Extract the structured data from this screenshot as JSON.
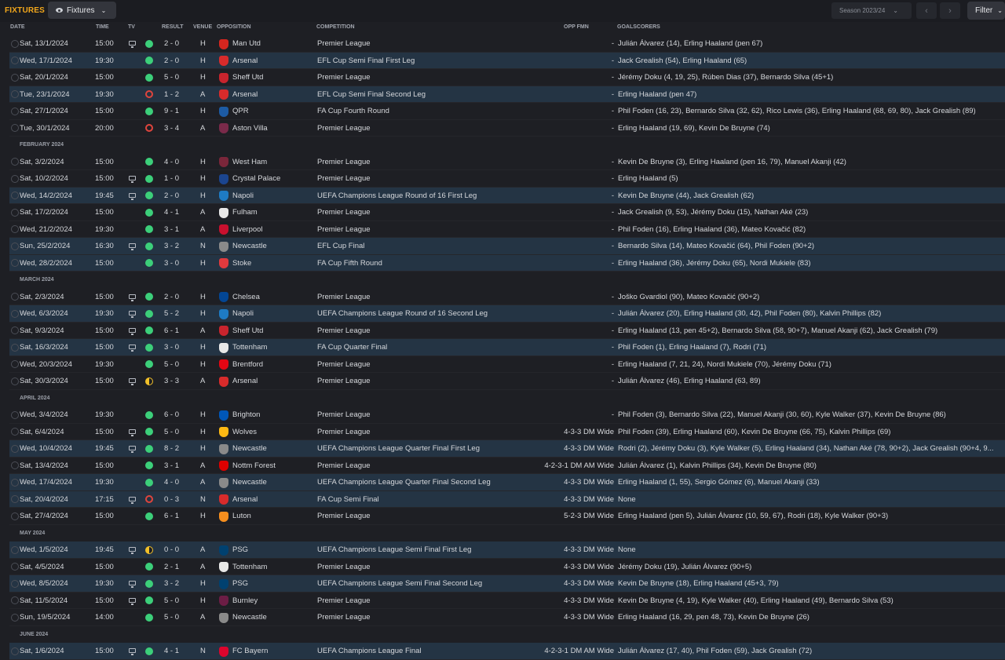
{
  "header": {
    "title": "FIXTURES",
    "view_dropdown": "Fixtures",
    "season": "Season 2023/24",
    "filter": "Filter"
  },
  "columns": {
    "date": "DATE",
    "time": "TIME",
    "tv": "TV",
    "result": "RESULT",
    "venue": "VENUE",
    "opposition": "OPPOSITION",
    "competition": "COMPETITION",
    "opp_fmn": "OPP FMN",
    "goalscorers": "GOALSCORERS"
  },
  "colors": {
    "win": "#3ccf7a",
    "loss": "#e0453d",
    "draw": "#f2c029",
    "accent": "#f2a71b",
    "highlight_row": "#243444"
  },
  "rows": [
    {
      "date": "Sat, 13/1/2024",
      "time": "15:00",
      "tv": true,
      "res": "W",
      "score": "2 - 0",
      "venue": "H",
      "opp": "Man Utd",
      "crest": "#d6261f",
      "comp": "Premier League",
      "fmn": "-",
      "scorers": "Julián Álvarez (14), Erling Haaland (pen 67)",
      "hl": false
    },
    {
      "date": "Wed, 17/1/2024",
      "time": "19:30",
      "tv": false,
      "res": "W",
      "score": "2 - 0",
      "venue": "H",
      "opp": "Arsenal",
      "crest": "#d82b2b",
      "comp": "EFL Cup Semi Final First Leg",
      "fmn": "-",
      "scorers": "Jack Grealish (54), Erling Haaland (65)",
      "hl": true
    },
    {
      "date": "Sat, 20/1/2024",
      "time": "15:00",
      "tv": false,
      "res": "W",
      "score": "5 - 0",
      "venue": "H",
      "opp": "Sheff Utd",
      "crest": "#c8242d",
      "comp": "Premier League",
      "fmn": "-",
      "scorers": "Jérémy Doku (4, 19, 25), Rúben Dias (37), Bernardo Silva (45+1)",
      "hl": false
    },
    {
      "date": "Tue, 23/1/2024",
      "time": "19:30",
      "tv": false,
      "res": "L",
      "score": "1 - 2",
      "venue": "A",
      "opp": "Arsenal",
      "crest": "#d82b2b",
      "comp": "EFL Cup Semi Final Second Leg",
      "fmn": "-",
      "scorers": "Erling Haaland (pen 47)",
      "hl": true
    },
    {
      "date": "Sat, 27/1/2024",
      "time": "15:00",
      "tv": false,
      "res": "W",
      "score": "9 - 1",
      "venue": "H",
      "opp": "QPR",
      "crest": "#1d5ba4",
      "comp": "FA Cup Fourth Round",
      "fmn": "-",
      "scorers": "Phil Foden (16, 23), Bernardo Silva (32, 62), Rico Lewis (36), Erling Haaland (68, 69, 80), Jack Grealish (89)",
      "hl": false
    },
    {
      "date": "Tue, 30/1/2024",
      "time": "20:00",
      "tv": false,
      "res": "L",
      "score": "3 - 4",
      "venue": "A",
      "opp": "Aston Villa",
      "crest": "#7a2a4a",
      "comp": "Premier League",
      "fmn": "-",
      "scorers": "Erling Haaland (19, 69), Kevin De Bruyne (74)",
      "hl": false
    },
    {
      "month": "FEBRUARY 2024"
    },
    {
      "date": "Sat, 3/2/2024",
      "time": "15:00",
      "tv": false,
      "res": "W",
      "score": "4 - 0",
      "venue": "H",
      "opp": "West Ham",
      "crest": "#7a263a",
      "comp": "Premier League",
      "fmn": "-",
      "scorers": "Kevin De Bruyne (3), Erling Haaland (pen 16, 79), Manuel Akanji (42)",
      "hl": false
    },
    {
      "date": "Sat, 10/2/2024",
      "time": "15:00",
      "tv": true,
      "res": "W",
      "score": "1 - 0",
      "venue": "H",
      "opp": "Crystal Palace",
      "crest": "#1b458f",
      "comp": "Premier League",
      "fmn": "-",
      "scorers": "Erling Haaland (5)",
      "hl": false
    },
    {
      "date": "Wed, 14/2/2024",
      "time": "19:45",
      "tv": true,
      "res": "W",
      "score": "2 - 0",
      "venue": "H",
      "opp": "Napoli",
      "crest": "#1e7bc4",
      "comp": "UEFA Champions League Round of 16 First Leg",
      "fmn": "-",
      "scorers": "Kevin De Bruyne (44), Jack Grealish (62)",
      "hl": true
    },
    {
      "date": "Sat, 17/2/2024",
      "time": "15:00",
      "tv": false,
      "res": "W",
      "score": "4 - 1",
      "venue": "A",
      "opp": "Fulham",
      "crest": "#e8e8e8",
      "comp": "Premier League",
      "fmn": "-",
      "scorers": "Jack Grealish (9, 53), Jérémy Doku (15), Nathan Aké (23)",
      "hl": false
    },
    {
      "date": "Wed, 21/2/2024",
      "time": "19:30",
      "tv": false,
      "res": "W",
      "score": "3 - 1",
      "venue": "A",
      "opp": "Liverpool",
      "crest": "#c8102e",
      "comp": "Premier League",
      "fmn": "-",
      "scorers": "Phil Foden (16), Erling Haaland (36), Mateo Kovačić (82)",
      "hl": false
    },
    {
      "date": "Sun, 25/2/2024",
      "time": "16:30",
      "tv": true,
      "res": "W",
      "score": "3 - 2",
      "venue": "N",
      "opp": "Newcastle",
      "crest": "#8a8a8a",
      "comp": "EFL Cup Final",
      "fmn": "-",
      "scorers": "Bernardo Silva (14), Mateo Kovačić (64), Phil Foden (90+2)",
      "hl": true
    },
    {
      "date": "Wed, 28/2/2024",
      "time": "15:00",
      "tv": false,
      "res": "W",
      "score": "3 - 0",
      "venue": "H",
      "opp": "Stoke",
      "crest": "#e03a3e",
      "comp": "FA Cup Fifth Round",
      "fmn": "-",
      "scorers": "Erling Haaland (36), Jérémy Doku (65), Nordi Mukiele (83)",
      "hl": true
    },
    {
      "month": "MARCH 2024"
    },
    {
      "date": "Sat, 2/3/2024",
      "time": "15:00",
      "tv": true,
      "res": "W",
      "score": "2 - 0",
      "venue": "H",
      "opp": "Chelsea",
      "crest": "#034694",
      "comp": "Premier League",
      "fmn": "-",
      "scorers": "Joško Gvardiol (90), Mateo Kovačić (90+2)",
      "hl": false
    },
    {
      "date": "Wed, 6/3/2024",
      "time": "19:30",
      "tv": true,
      "res": "W",
      "score": "5 - 2",
      "venue": "H",
      "opp": "Napoli",
      "crest": "#1e7bc4",
      "comp": "UEFA Champions League Round of 16 Second Leg",
      "fmn": "-",
      "scorers": "Julián Álvarez (20), Erling Haaland (30, 42), Phil Foden (80), Kalvin Phillips (82)",
      "hl": true
    },
    {
      "date": "Sat, 9/3/2024",
      "time": "15:00",
      "tv": true,
      "res": "W",
      "score": "6 - 1",
      "venue": "A",
      "opp": "Sheff Utd",
      "crest": "#c8242d",
      "comp": "Premier League",
      "fmn": "-",
      "scorers": "Erling Haaland (13, pen 45+2), Bernardo Silva (58, 90+7), Manuel Akanji (62), Jack Grealish (79)",
      "hl": false
    },
    {
      "date": "Sat, 16/3/2024",
      "time": "15:00",
      "tv": true,
      "res": "W",
      "score": "3 - 0",
      "venue": "H",
      "opp": "Tottenham",
      "crest": "#e8e8e8",
      "comp": "FA Cup Quarter Final",
      "fmn": "-",
      "scorers": "Phil Foden (1), Erling Haaland (7), Rodri (71)",
      "hl": true
    },
    {
      "date": "Wed, 20/3/2024",
      "time": "19:30",
      "tv": false,
      "res": "W",
      "score": "5 - 0",
      "venue": "H",
      "opp": "Brentford",
      "crest": "#e30613",
      "comp": "Premier League",
      "fmn": "-",
      "scorers": "Erling Haaland (7, 21, 24), Nordi Mukiele (70), Jérémy Doku (71)",
      "hl": false
    },
    {
      "date": "Sat, 30/3/2024",
      "time": "15:00",
      "tv": true,
      "res": "D",
      "score": "3 - 3",
      "venue": "A",
      "opp": "Arsenal",
      "crest": "#d82b2b",
      "comp": "Premier League",
      "fmn": "-",
      "scorers": "Julián Álvarez (46), Erling Haaland (63, 89)",
      "hl": false
    },
    {
      "month": "APRIL 2024"
    },
    {
      "date": "Wed, 3/4/2024",
      "time": "19:30",
      "tv": false,
      "res": "W",
      "score": "6 - 0",
      "venue": "H",
      "opp": "Brighton",
      "crest": "#0057b8",
      "comp": "Premier League",
      "fmn": "-",
      "scorers": "Phil Foden (3), Bernardo Silva (22), Manuel Akanji (30, 60), Kyle Walker (37), Kevin De Bruyne (86)",
      "hl": false
    },
    {
      "date": "Sat, 6/4/2024",
      "time": "15:00",
      "tv": true,
      "res": "W",
      "score": "5 - 0",
      "venue": "H",
      "opp": "Wolves",
      "crest": "#fdb913",
      "comp": "Premier League",
      "fmn": "4-3-3 DM Wide",
      "scorers": "Phil Foden (39), Erling Haaland (60), Kevin De Bruyne (66, 75), Kalvin Phillips (69)",
      "hl": false
    },
    {
      "date": "Wed, 10/4/2024",
      "time": "19:45",
      "tv": true,
      "res": "W",
      "score": "8 - 2",
      "venue": "H",
      "opp": "Newcastle",
      "crest": "#8a8a8a",
      "comp": "UEFA Champions League Quarter Final First Leg",
      "fmn": "4-3-3 DM Wide",
      "scorers": "Rodri (2), Jérémy Doku (3), Kyle Walker (5), Erling Haaland (34), Nathan Aké (78, 90+2), Jack Grealish (90+4, 9...",
      "hl": true
    },
    {
      "date": "Sat, 13/4/2024",
      "time": "15:00",
      "tv": false,
      "res": "W",
      "score": "3 - 1",
      "venue": "A",
      "opp": "Nottm Forest",
      "crest": "#dd0000",
      "comp": "Premier League",
      "fmn": "4-2-3-1 DM AM Wide",
      "scorers": "Julián Álvarez (1), Kalvin Phillips (34), Kevin De Bruyne (80)",
      "hl": false
    },
    {
      "date": "Wed, 17/4/2024",
      "time": "19:30",
      "tv": false,
      "res": "W",
      "score": "4 - 0",
      "venue": "A",
      "opp": "Newcastle",
      "crest": "#8a8a8a",
      "comp": "UEFA Champions League Quarter Final Second Leg",
      "fmn": "4-3-3 DM Wide",
      "scorers": "Erling Haaland (1, 55), Sergio Gómez (6), Manuel Akanji (33)",
      "hl": true
    },
    {
      "date": "Sat, 20/4/2024",
      "time": "17:15",
      "tv": true,
      "res": "L",
      "score": "0 - 3",
      "venue": "N",
      "opp": "Arsenal",
      "crest": "#d82b2b",
      "comp": "FA Cup Semi Final",
      "fmn": "4-3-3 DM Wide",
      "scorers": "None",
      "hl": true
    },
    {
      "date": "Sat, 27/4/2024",
      "time": "15:00",
      "tv": false,
      "res": "W",
      "score": "6 - 1",
      "venue": "H",
      "opp": "Luton",
      "crest": "#f78f1e",
      "comp": "Premier League",
      "fmn": "5-2-3 DM Wide",
      "scorers": "Erling Haaland (pen 5), Julián Álvarez (10, 59, 67), Rodri (18), Kyle Walker (90+3)",
      "hl": false
    },
    {
      "month": "MAY 2024"
    },
    {
      "date": "Wed, 1/5/2024",
      "time": "19:45",
      "tv": true,
      "res": "D",
      "score": "0 - 0",
      "venue": "A",
      "opp": "PSG",
      "crest": "#004170",
      "comp": "UEFA Champions League Semi Final First Leg",
      "fmn": "4-3-3 DM Wide",
      "scorers": "None",
      "hl": true
    },
    {
      "date": "Sat, 4/5/2024",
      "time": "15:00",
      "tv": false,
      "res": "W",
      "score": "2 - 1",
      "venue": "A",
      "opp": "Tottenham",
      "crest": "#e8e8e8",
      "comp": "Premier League",
      "fmn": "4-3-3 DM Wide",
      "scorers": "Jérémy Doku (19), Julián Álvarez (90+5)",
      "hl": false
    },
    {
      "date": "Wed, 8/5/2024",
      "time": "19:30",
      "tv": true,
      "res": "W",
      "score": "3 - 2",
      "venue": "H",
      "opp": "PSG",
      "crest": "#004170",
      "comp": "UEFA Champions League Semi Final Second Leg",
      "fmn": "4-3-3 DM Wide",
      "scorers": "Kevin De Bruyne (18), Erling Haaland (45+3, 79)",
      "hl": true
    },
    {
      "date": "Sat, 11/5/2024",
      "time": "15:00",
      "tv": true,
      "res": "W",
      "score": "5 - 0",
      "venue": "H",
      "opp": "Burnley",
      "crest": "#6c1d45",
      "comp": "Premier League",
      "fmn": "4-3-3 DM Wide",
      "scorers": "Kevin De Bruyne (4, 19), Kyle Walker (40), Erling Haaland (49), Bernardo Silva (53)",
      "hl": false
    },
    {
      "date": "Sun, 19/5/2024",
      "time": "14:00",
      "tv": false,
      "res": "W",
      "score": "5 - 0",
      "venue": "A",
      "opp": "Newcastle",
      "crest": "#8a8a8a",
      "comp": "Premier League",
      "fmn": "4-3-3 DM Wide",
      "scorers": "Erling Haaland (16, 29, pen 48, 73), Kevin De Bruyne (26)",
      "hl": false
    },
    {
      "month": "JUNE 2024"
    },
    {
      "date": "Sat, 1/6/2024",
      "time": "15:00",
      "tv": true,
      "res": "W",
      "score": "4 - 1",
      "venue": "N",
      "opp": "FC Bayern",
      "crest": "#dc052d",
      "comp": "UEFA Champions League Final",
      "fmn": "4-2-3-1 DM AM Wide",
      "scorers": "Julián Álvarez (17, 40), Phil Foden (59), Jack Grealish (72)",
      "hl": true
    }
  ]
}
